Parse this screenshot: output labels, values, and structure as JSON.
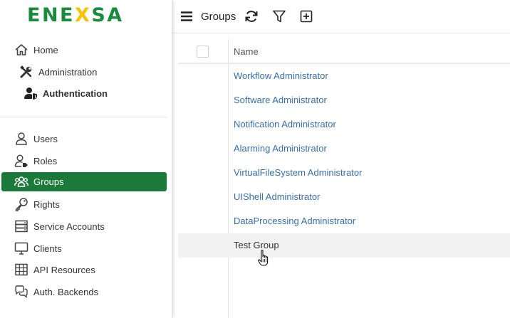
{
  "brand": {
    "logo_pre": "ENE",
    "logo_x": "X",
    "logo_post": "SA",
    "primary_color": "#1b7a3a",
    "accent_color": "#f5c400"
  },
  "sidebar": {
    "top_items": [
      {
        "label": "Home",
        "icon": "home-icon"
      },
      {
        "label": "Administration",
        "icon": "tools-icon"
      },
      {
        "label": "Authentication",
        "icon": "user-shield-icon",
        "bold": true
      }
    ],
    "items": [
      {
        "label": "Users",
        "icon": "user-icon"
      },
      {
        "label": "Roles",
        "icon": "user-tag-icon"
      },
      {
        "label": "Groups",
        "icon": "users-icon",
        "active": true
      },
      {
        "label": "Rights",
        "icon": "key-icon"
      },
      {
        "label": "Service Accounts",
        "icon": "server-icon"
      },
      {
        "label": "Clients",
        "icon": "monitor-icon"
      },
      {
        "label": "API Resources",
        "icon": "table-icon"
      },
      {
        "label": "Auth. Backends",
        "icon": "comments-icon"
      }
    ]
  },
  "toolbar": {
    "title": "Groups",
    "menu_icon": "hamburger-icon",
    "refresh_icon": "refresh-icon",
    "filter_icon": "filter-icon",
    "add_icon": "add-icon"
  },
  "grid": {
    "column_name": "Name",
    "rows": [
      "Workflow Administrator",
      "Software Administrator",
      "Notification Administrator",
      "Alarming Administrator",
      "VirtualFileSystem Administrator",
      "UIShell Administrator",
      "DataProcessing Administrator",
      "Test Group"
    ],
    "hovered_row": 7
  }
}
